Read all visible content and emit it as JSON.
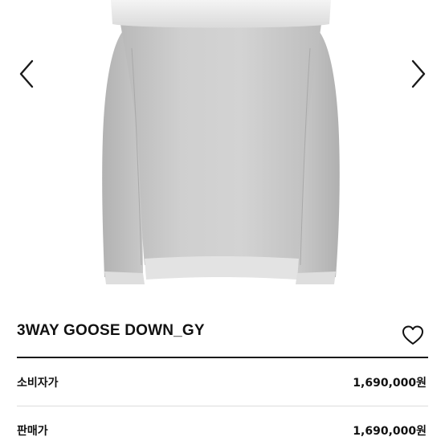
{
  "product": {
    "title": "3WAY GOOSE DOWN_GY"
  },
  "icons": {
    "prev": "chevron-left-icon",
    "next": "chevron-right-icon",
    "wishlist": "heart-outline-icon"
  },
  "prices": {
    "consumer_label": "소비자가",
    "consumer_value": "1,690,000원",
    "sale_label": "판매가",
    "sale_value": "1,690,000원"
  },
  "colors": {
    "jacket": "#c9c9c9",
    "text": "#111111"
  }
}
